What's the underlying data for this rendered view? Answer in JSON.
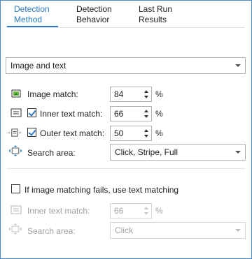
{
  "tabs": [
    {
      "line1": "Detection",
      "line2": "Method"
    },
    {
      "line1": "Detection",
      "line2": "Behavior"
    },
    {
      "line1": "Last Run",
      "line2": "Results"
    }
  ],
  "method_select": {
    "value": "Image and text"
  },
  "image_match": {
    "label": "Image match:",
    "value": "84",
    "unit": "%"
  },
  "inner_text_match": {
    "label": "Inner text match:",
    "value": "66",
    "unit": "%",
    "checked": true
  },
  "outer_text_match": {
    "label": "Outer text match:",
    "value": "50",
    "unit": "%",
    "checked": true
  },
  "search_area": {
    "label": "Search area:",
    "value": "Click, Stripe, Full"
  },
  "fallback": {
    "checkbox_label": "If image matching fails, use text matching",
    "checked": false,
    "inner_text_match": {
      "label": "Inner text match:",
      "value": "66",
      "unit": "%"
    },
    "search_area": {
      "label": "Search area:",
      "value": "Click"
    }
  },
  "colors": {
    "accent": "#2b7bc2",
    "border": "#4a8bc9"
  }
}
